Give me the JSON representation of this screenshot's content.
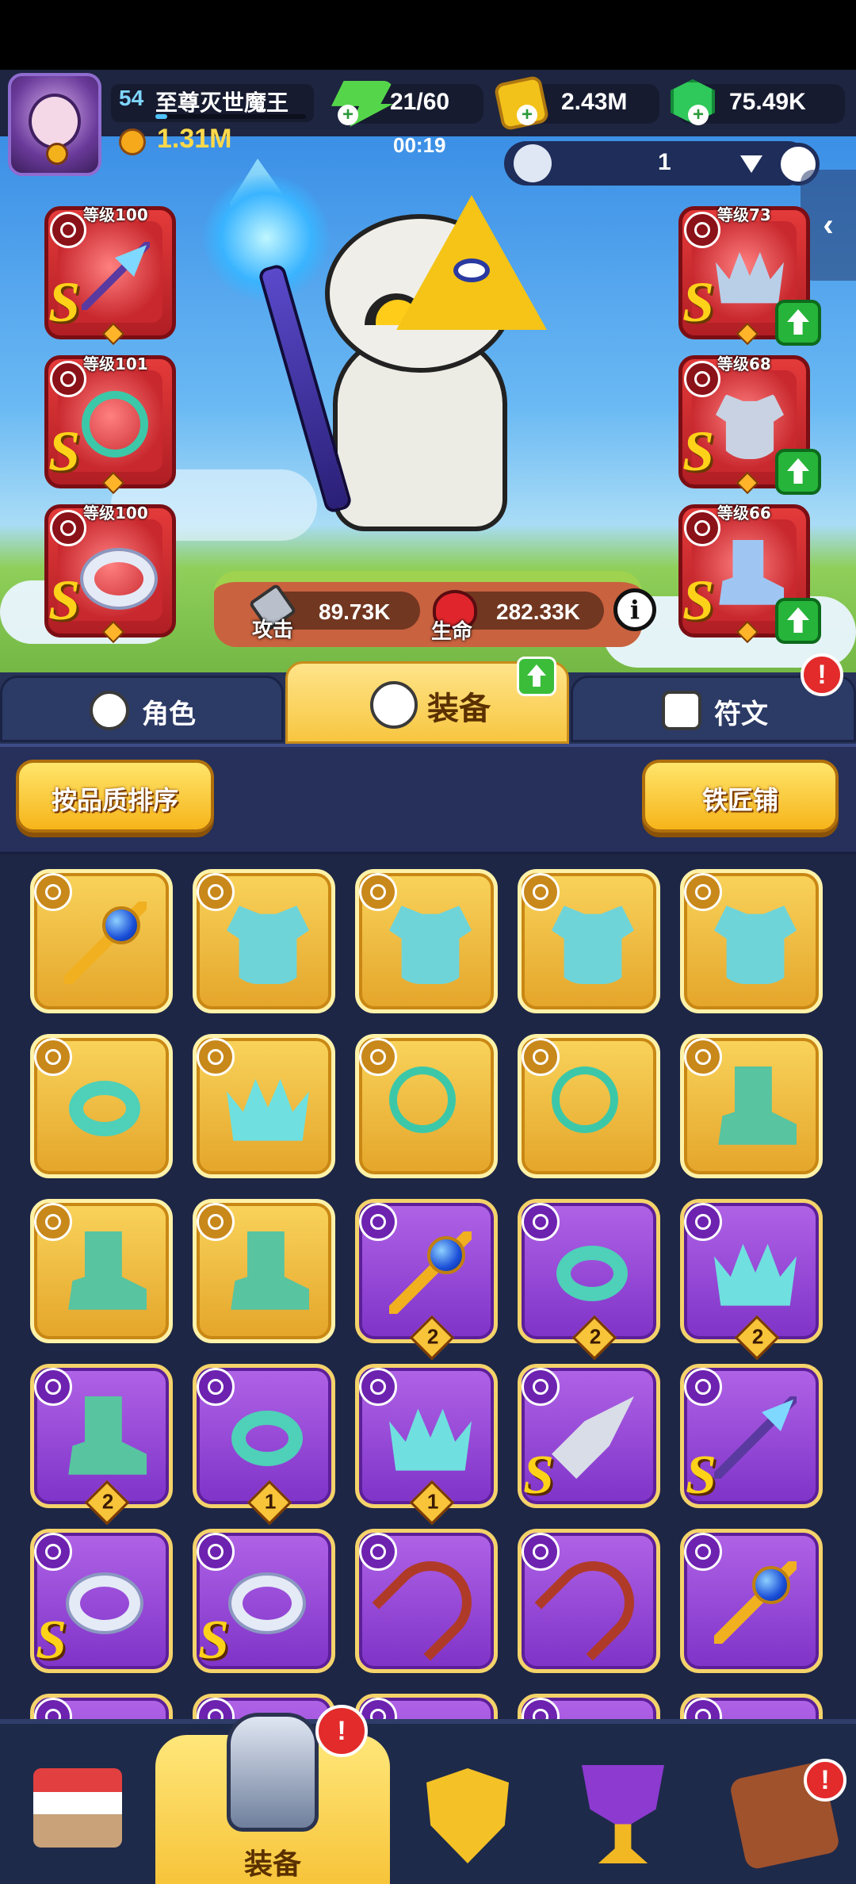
{
  "player": {
    "level": "54",
    "name": "至尊灭世魔王",
    "power": "1.31M",
    "xp_fraction": 0.08
  },
  "resources": {
    "energy": "21/60",
    "energy_timer": "00:19",
    "gold": "2.43M",
    "gems": "75.49K"
  },
  "loadout_selector": {
    "value": "1"
  },
  "hero_stats": {
    "attack_label": "攻击",
    "attack_value": "89.73K",
    "hp_label": "生命",
    "hp_value": "282.33K"
  },
  "equipped": {
    "weapon": {
      "level_label": "等级100",
      "grade": "S",
      "icon": "spear-icon"
    },
    "necklace": {
      "level_label": "等级101",
      "grade": "S",
      "icon": "necklace-icon"
    },
    "ring": {
      "level_label": "等级100",
      "grade": "S",
      "icon": "ring-icon"
    },
    "helmet": {
      "level_label": "等级73",
      "grade": "S",
      "icon": "helmet-icon",
      "upgradable": true
    },
    "armor": {
      "level_label": "等级68",
      "grade": "S",
      "icon": "armor-icon",
      "upgradable": true
    },
    "boots": {
      "level_label": "等级66",
      "grade": "S",
      "icon": "boots-icon",
      "upgradable": true
    }
  },
  "tabs": [
    {
      "label": "角色",
      "active": false
    },
    {
      "label": "装备",
      "active": true
    },
    {
      "label": "符文",
      "active": false
    }
  ],
  "sort_button_label": "按品质排序",
  "forge_button_label": "铁匠铺",
  "inventory": [
    {
      "rarity": "gold",
      "item": "staff"
    },
    {
      "rarity": "gold",
      "item": "armor"
    },
    {
      "rarity": "gold",
      "item": "armor"
    },
    {
      "rarity": "gold",
      "item": "armor"
    },
    {
      "rarity": "gold",
      "item": "armor"
    },
    {
      "rarity": "gold",
      "item": "ring"
    },
    {
      "rarity": "gold",
      "item": "crown"
    },
    {
      "rarity": "gold",
      "item": "necklace"
    },
    {
      "rarity": "gold",
      "item": "necklace"
    },
    {
      "rarity": "gold",
      "item": "boots"
    },
    {
      "rarity": "gold",
      "item": "boots"
    },
    {
      "rarity": "gold",
      "item": "boots"
    },
    {
      "rarity": "purple",
      "item": "staff",
      "count": "2"
    },
    {
      "rarity": "purple",
      "item": "ring",
      "count": "2"
    },
    {
      "rarity": "purple",
      "item": "crown",
      "count": "2"
    },
    {
      "rarity": "purple",
      "item": "boots",
      "count": "2"
    },
    {
      "rarity": "purple",
      "item": "ring",
      "count": "1"
    },
    {
      "rarity": "purple",
      "item": "crown",
      "count": "1"
    },
    {
      "rarity": "purple",
      "item": "arrow",
      "grade": "S"
    },
    {
      "rarity": "purple",
      "item": "spear",
      "grade": "S"
    },
    {
      "rarity": "purple",
      "item": "ring2",
      "grade": "S"
    },
    {
      "rarity": "purple",
      "item": "ring2",
      "grade": "S"
    },
    {
      "rarity": "purple",
      "item": "bow"
    },
    {
      "rarity": "purple",
      "item": "bow"
    },
    {
      "rarity": "purple",
      "item": "staff"
    }
  ],
  "bottom_nav": {
    "active_label": "装备"
  },
  "badges": {
    "rune_tab": "!",
    "equip_nav": "!",
    "event_nav": "!"
  }
}
